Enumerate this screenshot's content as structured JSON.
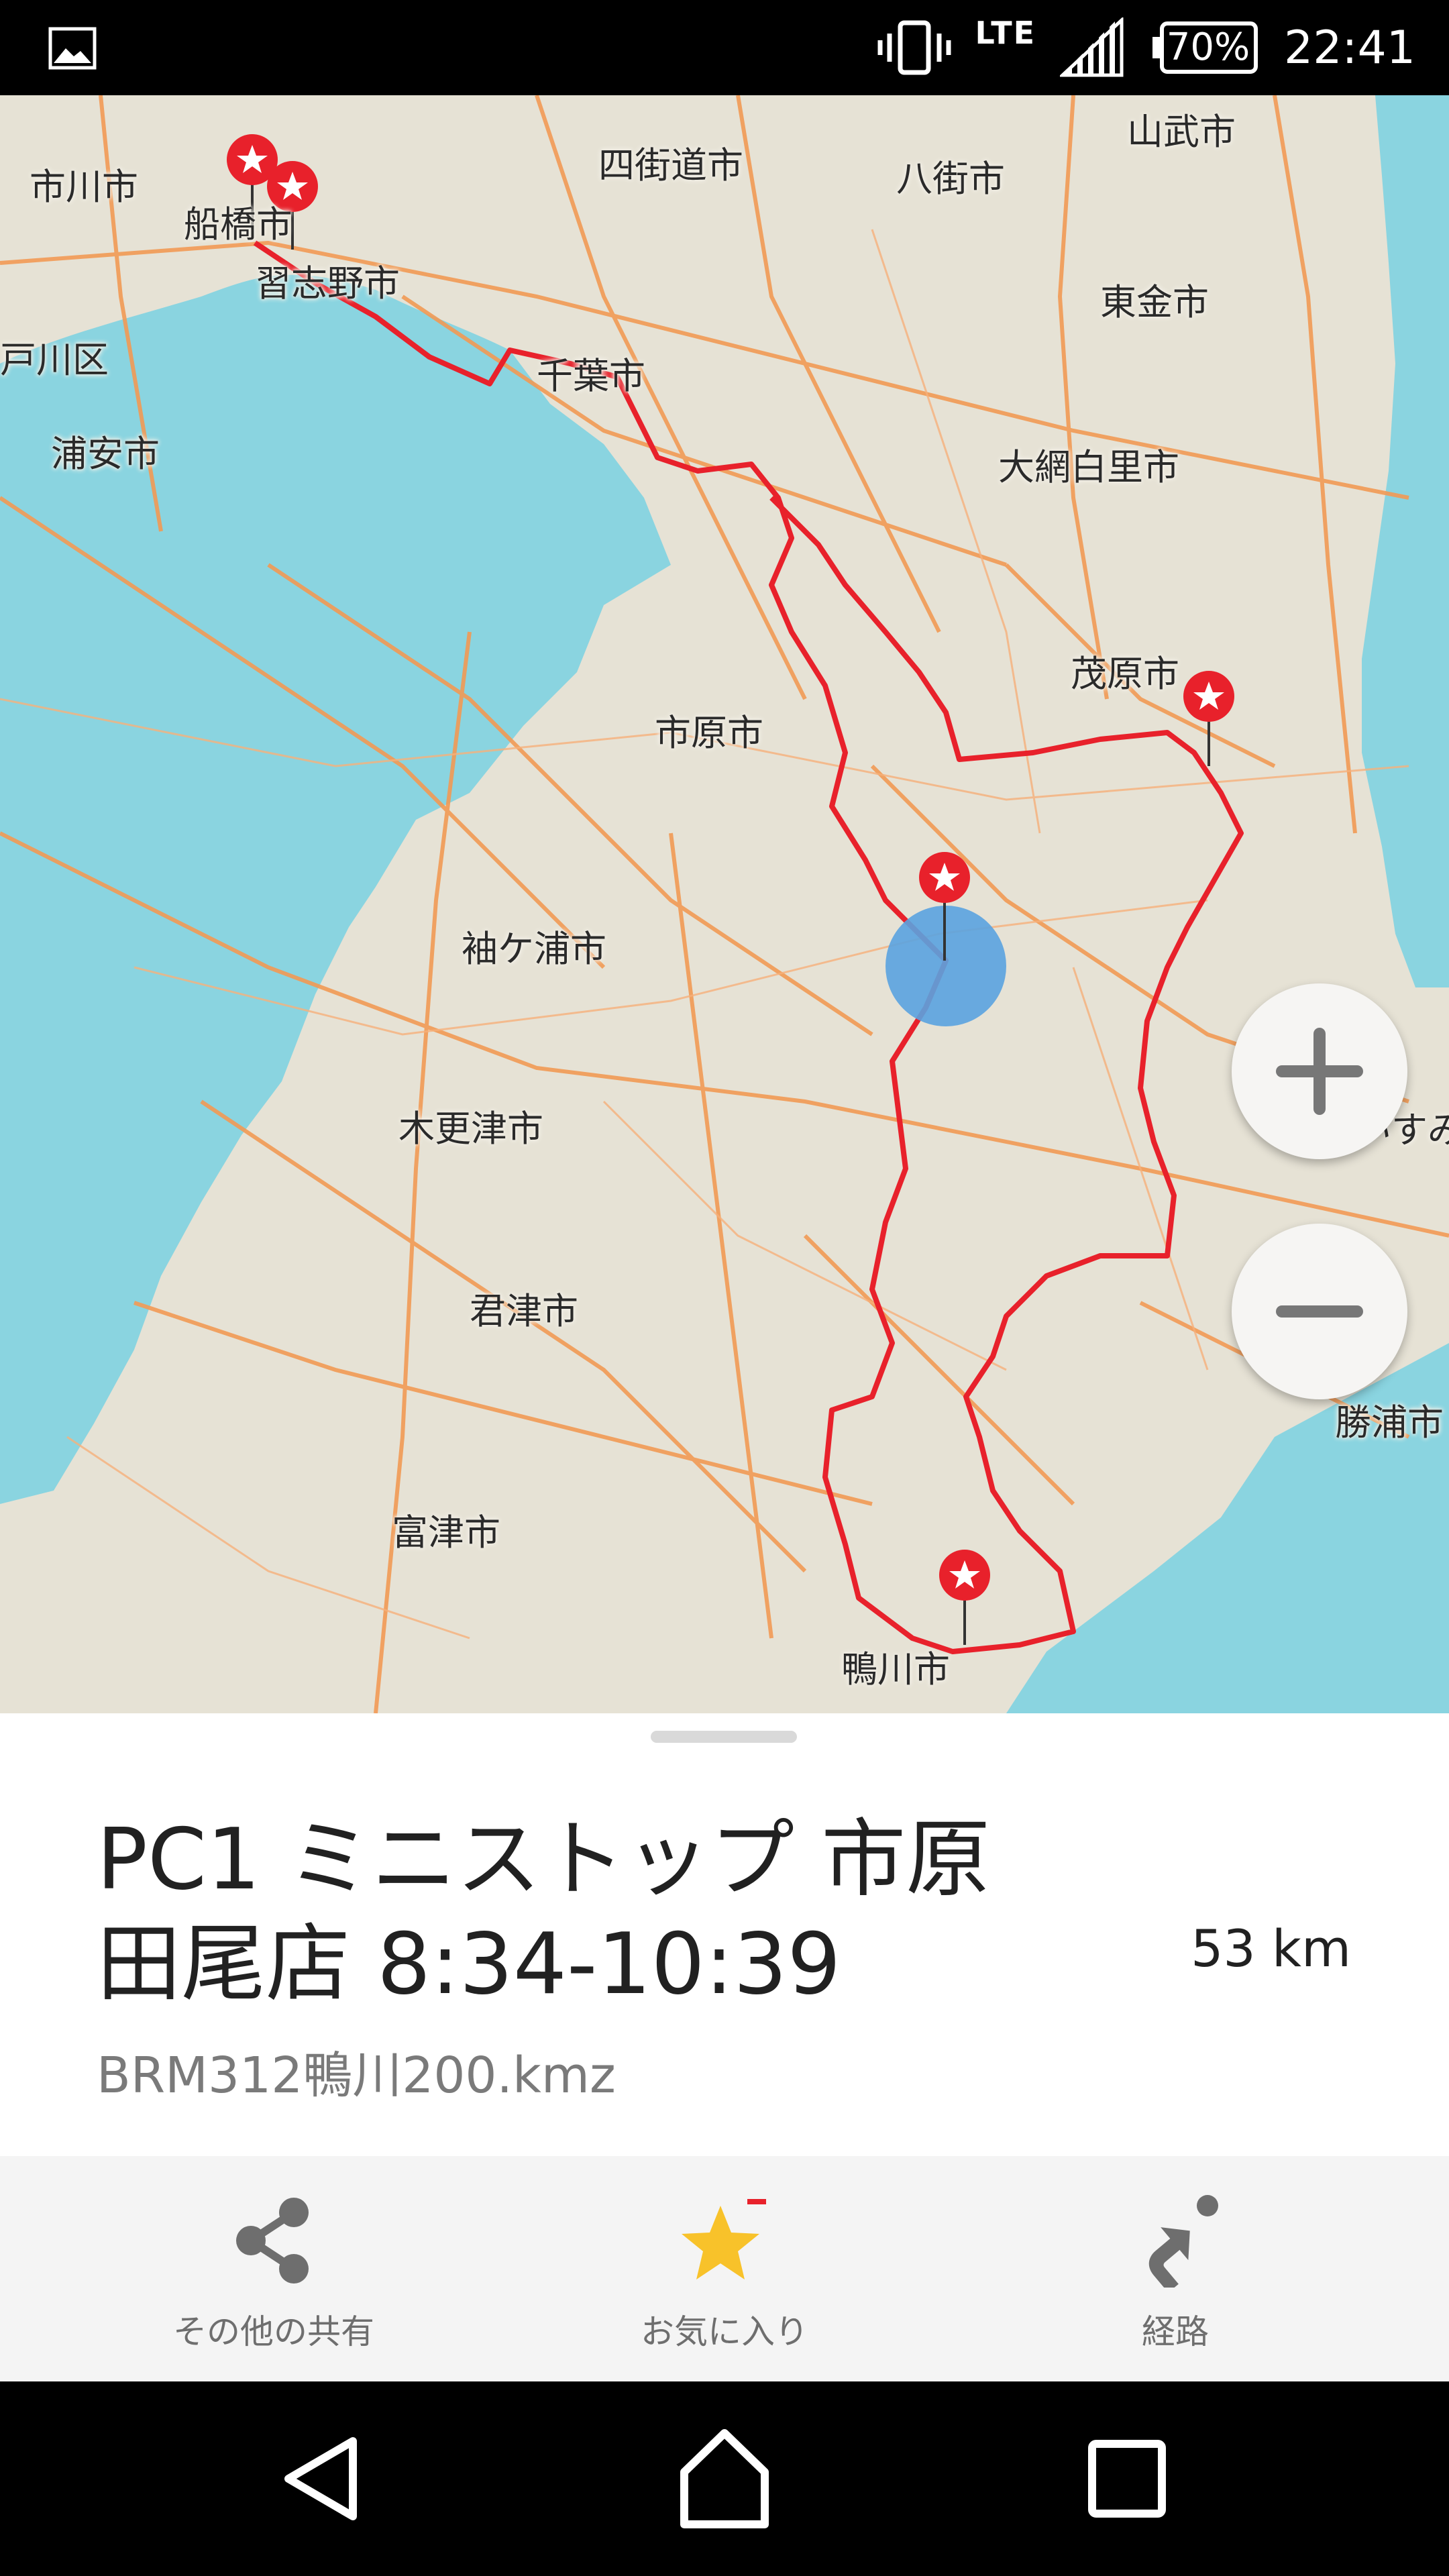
{
  "status_bar": {
    "network": "LTE",
    "battery": "70%",
    "time": "22:41"
  },
  "map": {
    "cities": {
      "ichikawa": "市川市",
      "funabashi": "船橋市",
      "yotsukaido": "四街道市",
      "yachimata": "八街市",
      "sammu": "山武市",
      "narashino": "習志野市",
      "togane": "東金市",
      "edogawa": "戸川区",
      "chiba": "千葉市",
      "urayasu": "浦安市",
      "oamishirasato": "大網白里市",
      "mobara": "茂原市",
      "ichihara": "市原市",
      "sodegaura": "袖ケ浦市",
      "kisarazu": "木更津市",
      "isumi": "いすみ",
      "kimitsu": "君津市",
      "katsuura": "勝浦市",
      "futtsu": "富津市",
      "kamogawa": "鴨川市"
    },
    "route_color": "#e8212b",
    "road_color": "#f29a55",
    "water_color": "#8ad4e0",
    "land_color": "#e6e2d5",
    "location_color": "#5aa3e0"
  },
  "zoom": {
    "in_icon": "plus-icon",
    "out_icon": "minus-icon"
  },
  "place": {
    "title": "PC1 ミニストップ 市原田尾店 8:34-10:39",
    "distance": "53 km",
    "file": "BRM312鴨川200.kmz"
  },
  "actions": [
    {
      "label": "その他の共有",
      "icon": "share-icon"
    },
    {
      "label": "お気に入り",
      "icon": "star-icon",
      "color": "#f8c22a"
    },
    {
      "label": "経路",
      "icon": "directions-icon"
    }
  ],
  "nav": {
    "back_icon": "back-icon",
    "home_icon": "home-icon",
    "recents_icon": "recents-icon"
  }
}
